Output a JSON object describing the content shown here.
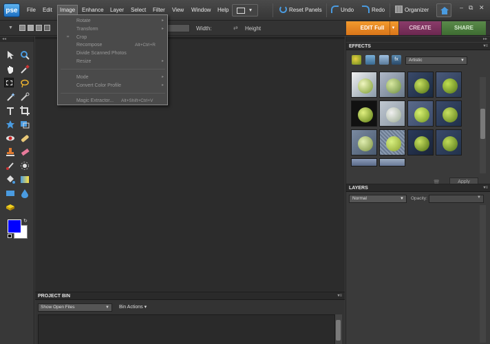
{
  "app": {
    "logo": "pse"
  },
  "menubar": {
    "items": [
      "File",
      "Edit",
      "Image",
      "Enhance",
      "Layer",
      "Select",
      "Filter",
      "View",
      "Window",
      "Help"
    ],
    "reset_panels": "Reset Panels",
    "undo": "Undo",
    "redo": "Redo",
    "organizer": "Organizer",
    "window_controls": {
      "minimize": "–",
      "restore": "⧉",
      "close": "✕"
    }
  },
  "options_bar": {
    "width_label": "Width:",
    "height_label": "Height"
  },
  "mode_tabs": {
    "edit": "EDIT Full",
    "create": "CREATE",
    "share": "SHARE"
  },
  "image_menu": {
    "items": [
      {
        "label": "Rotate",
        "submenu": true
      },
      {
        "label": "Transform",
        "submenu": true
      },
      {
        "label": "Crop",
        "checked": true
      },
      {
        "label": "Recompose",
        "shortcut": "Alt+Ctrl+R"
      },
      {
        "label": "Divide Scanned Photos"
      },
      {
        "label": "Resize",
        "submenu": true
      },
      {
        "label": "Mode",
        "submenu": true
      },
      {
        "label": "Convert Color Profile",
        "submenu": true
      },
      {
        "label": "Magic Extractor...",
        "shortcut": "Alt+Shift+Ctrl+V"
      }
    ]
  },
  "project_bin": {
    "title": "PROJECT BIN",
    "show_select": "Show Open Files",
    "bin_actions": "Bin Actions"
  },
  "effects": {
    "title": "EFFECTS",
    "category": "Artistic",
    "apply_label": "Apply"
  },
  "layers": {
    "title": "LAYERS",
    "blend_mode": "Normal",
    "opacity_label": "Opacity:"
  },
  "colors": {
    "foreground": "#0000ff",
    "background": "#ffffff",
    "accent": "#f29a2e"
  }
}
